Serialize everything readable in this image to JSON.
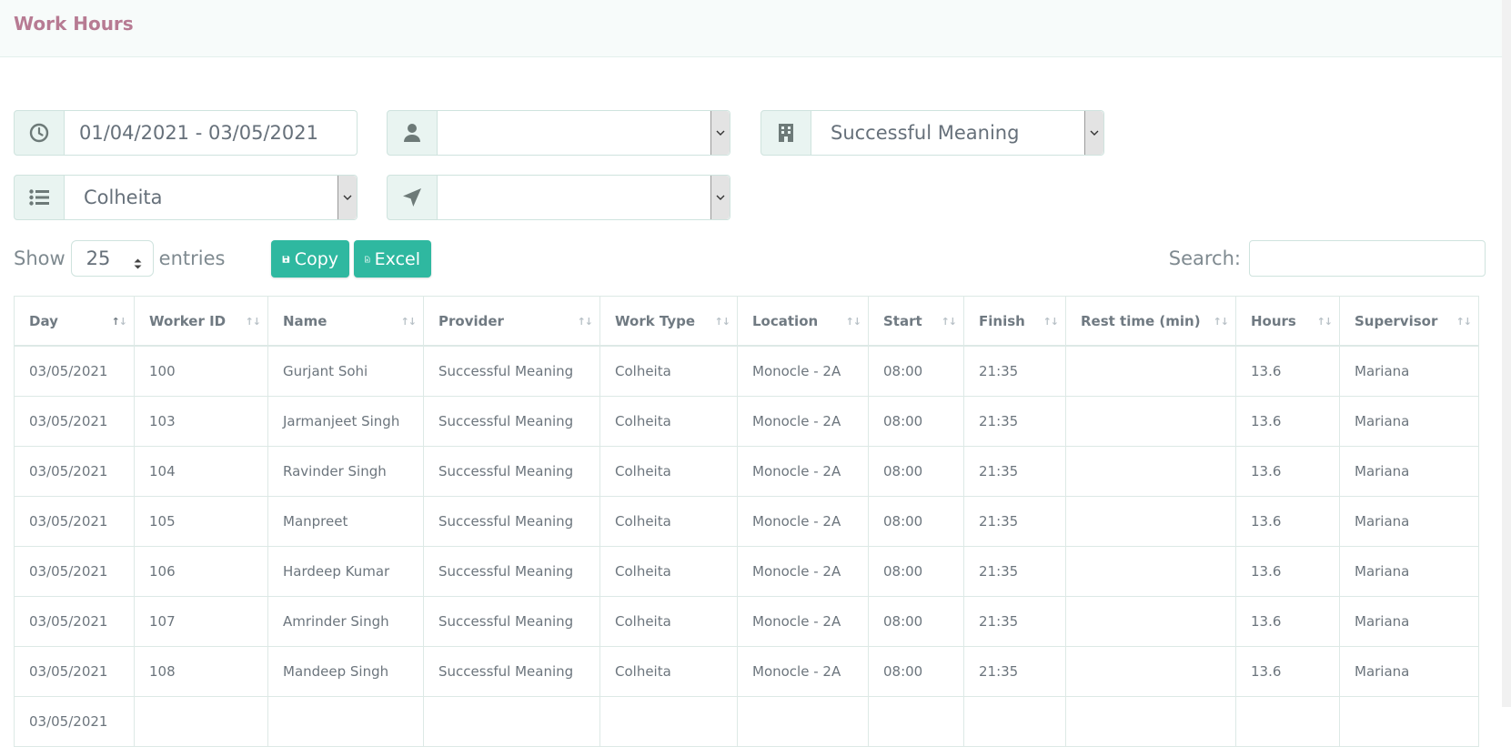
{
  "header": {
    "title": "Work Hours"
  },
  "filters": {
    "date_range": "01/04/2021 - 03/05/2021",
    "worker": "",
    "provider": "Successful Meaning",
    "work_type": "Colheita",
    "location": ""
  },
  "controls": {
    "show_label": "Show",
    "entries_value": "25",
    "entries_label": "entries",
    "copy_label": "Copy",
    "excel_label": "Excel",
    "search_label": "Search:",
    "search_value": ""
  },
  "table": {
    "columns": [
      "Day",
      "Worker ID",
      "Name",
      "Provider",
      "Work Type",
      "Location",
      "Start",
      "Finish",
      "Rest time (min)",
      "Hours",
      "Supervisor"
    ],
    "rows": [
      [
        "03/05/2021",
        "100",
        "Gurjant Sohi",
        "Successful Meaning",
        "Colheita",
        "Monocle - 2A",
        "08:00",
        "21:35",
        "",
        "13.6",
        "Mariana"
      ],
      [
        "03/05/2021",
        "103",
        "Jarmanjeet Singh",
        "Successful Meaning",
        "Colheita",
        "Monocle - 2A",
        "08:00",
        "21:35",
        "",
        "13.6",
        "Mariana"
      ],
      [
        "03/05/2021",
        "104",
        "Ravinder Singh",
        "Successful Meaning",
        "Colheita",
        "Monocle - 2A",
        "08:00",
        "21:35",
        "",
        "13.6",
        "Mariana"
      ],
      [
        "03/05/2021",
        "105",
        "Manpreet",
        "Successful Meaning",
        "Colheita",
        "Monocle - 2A",
        "08:00",
        "21:35",
        "",
        "13.6",
        "Mariana"
      ],
      [
        "03/05/2021",
        "106",
        "Hardeep Kumar",
        "Successful Meaning",
        "Colheita",
        "Monocle - 2A",
        "08:00",
        "21:35",
        "",
        "13.6",
        "Mariana"
      ],
      [
        "03/05/2021",
        "107",
        "Amrinder Singh",
        "Successful Meaning",
        "Colheita",
        "Monocle - 2A",
        "08:00",
        "21:35",
        "",
        "13.6",
        "Mariana"
      ],
      [
        "03/05/2021",
        "108",
        "Mandeep Singh",
        "Successful Meaning",
        "Colheita",
        "Monocle - 2A",
        "08:00",
        "21:35",
        "",
        "13.6",
        "Mariana"
      ],
      [
        "03/05/2021",
        "",
        "",
        "",
        "",
        "",
        "",
        "",
        "",
        "",
        ""
      ]
    ]
  },
  "colors": {
    "accent": "#2fb8a0",
    "title": "#b77b93",
    "addon_bg": "#e9f4f1"
  }
}
